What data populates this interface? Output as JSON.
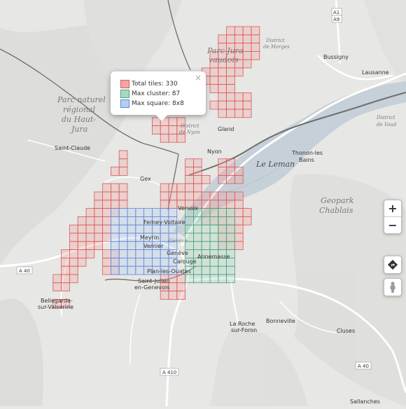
{
  "popup": {
    "close_label": "×",
    "legend": [
      {
        "label": "Total tiles: 330",
        "fill": "#f2a6a3",
        "border": "#d85b57"
      },
      {
        "label": "Max cluster: 87",
        "fill": "#a6d9c0",
        "border": "#4ea07a"
      },
      {
        "label": "Max square: 8x8",
        "fill": "#b5cdf2",
        "border": "#5f88d6"
      }
    ]
  },
  "map": {
    "places": {
      "lausanne": "Lausanne",
      "bussigny": "Bussigny",
      "saint_claude": "Saint-Claude",
      "gex": "Gex",
      "nyon": "Nyon",
      "gland": "Gland",
      "thonon": "Thonon-les",
      "thonon2": "Bains",
      "versoix": "Versoix",
      "ferney": "Ferney-Voltaire",
      "meyrin": "Meyrin",
      "vernier": "Vernier",
      "geneve": "Genève",
      "carouge": "Carouge",
      "plan": "Plan-les-Ouates",
      "annemasse": "Annemasse",
      "saint_julien": "Saint-Julien",
      "saint_julien2": "en-Genevois",
      "bellegarde": "Bellegarde-",
      "bellegarde2": "sur-Valserine",
      "bonneville": "Bonneville",
      "cluses": "Cluses",
      "la_roche": "La Roche",
      "la_roche2": "sur-Foron",
      "sallanches": "Sallanches",
      "geneve_it": "Genève"
    },
    "regions": {
      "parc_jura_1": "Parc Jura",
      "parc_jura_2": "vaudois",
      "parc_haut_1": "Parc naturel",
      "parc_haut_2": "régional",
      "parc_haut_3": "du Haut-",
      "parc_haut_4": "Jura",
      "le_leman": "Le Leman",
      "geopark_1": "Geopark",
      "geopark_2": "Chablais",
      "district_morges_1": "District",
      "district_morges_2": "de Morges",
      "district_nyon_1": "District",
      "district_nyon_2": "de Nyon",
      "district_vaud_1": "District",
      "district_vaud_2": "de Vaud"
    },
    "roads": {
      "a1": "A1",
      "a9": "A9",
      "a40_left": "A 40",
      "a40_right": "A 40",
      "a410": "A 410"
    }
  },
  "controls": {
    "zoom_in": "+",
    "zoom_out": "−"
  }
}
